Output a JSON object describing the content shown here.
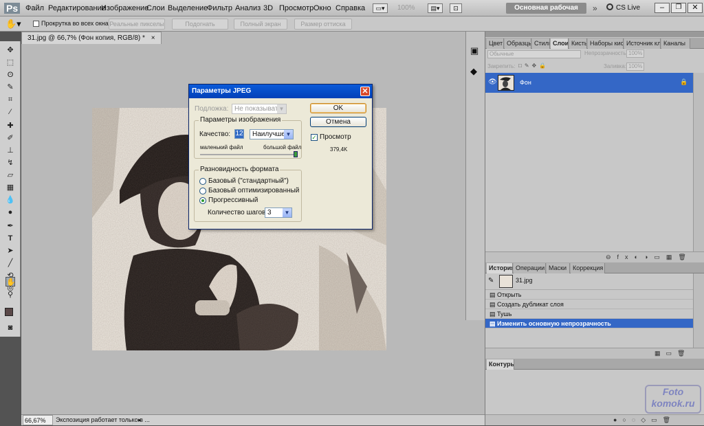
{
  "app": {
    "logo": "Ps"
  },
  "menu": [
    "Файл",
    "Редактирование",
    "Изображение",
    "Слои",
    "Выделение",
    "Фильтр",
    "Анализ",
    "3D",
    "Просмотр",
    "Окно",
    "Справка"
  ],
  "menubar_right": {
    "zoom": "100%",
    "workspace": "Основная рабочая среда",
    "cs_live": "CS Live"
  },
  "options": {
    "checkbox_label": "Прокрутка во всех окнах",
    "buttons": [
      "Реальные пикселы",
      "Подогнать",
      "Полный экран",
      "Размер оттиска"
    ]
  },
  "document": {
    "tab_title": "31.jpg @ 66,7% (Фон копия, RGB/8) *",
    "status_zoom": "66,67%",
    "status_text": "Экспозиция работает только в ..."
  },
  "layers_panel": {
    "tabs": [
      "Цвет",
      "Образцы",
      "Стили",
      "Слои",
      "Кисть",
      "Наборы кистей",
      "Источник кл",
      "Каналы"
    ],
    "blend_mode": "Обычные",
    "opacity_label": "Непрозрачность:",
    "opacity_value": "100%",
    "lock_label": "Закрепить:",
    "fill_label": "Заливка:",
    "fill_value": "100%",
    "layer_name": "Фон"
  },
  "history_panel": {
    "tabs": [
      "История",
      "Операции",
      "Маски",
      "Коррекция"
    ],
    "snapshot": "31.jpg",
    "items": [
      "Открыть",
      "Создать дубликат слоя",
      "Тушь",
      "Изменить основную непрозрачность"
    ]
  },
  "contours_panel": {
    "tab": "Контуры"
  },
  "watermark": {
    "line1": "Foto",
    "line2": "komok.ru"
  },
  "dialog": {
    "title": "Параметры JPEG",
    "matte_label": "Подложка:",
    "matte_value": "Не показывать",
    "image_options_label": "Параметры изображения",
    "quality_label": "Качество:",
    "quality_value": "12",
    "quality_preset": "Наилучшее",
    "small_file": "маленький файл",
    "large_file": "большой файл",
    "format_label": "Разновидность формата",
    "formats": [
      "Базовый (\"стандартный\")",
      "Базовый оптимизированный",
      "Прогрессивный"
    ],
    "selected_format_index": 2,
    "scans_label": "Количество шагов:",
    "scans_value": "3",
    "ok": "OK",
    "cancel": "Отмена",
    "preview_label": "Просмотр",
    "file_size": "379,4K"
  }
}
